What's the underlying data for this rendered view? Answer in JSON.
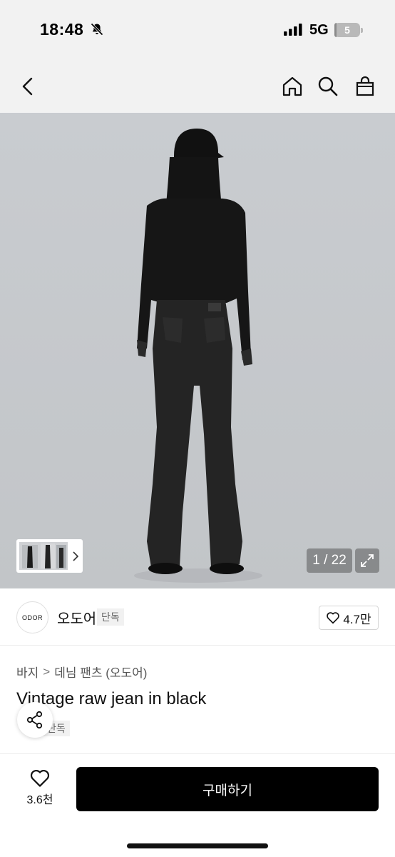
{
  "status_bar": {
    "time": "18:48",
    "network": "5G",
    "battery_level": "5",
    "battery_fraction": 0.05,
    "icons": [
      "bell-slash-icon",
      "signal-icon",
      "battery-icon"
    ]
  },
  "nav": {
    "icons": [
      "chevron-left-icon",
      "home-icon",
      "search-icon",
      "shopping-bag-icon"
    ]
  },
  "gallery": {
    "page_counter": "1 / 22",
    "icons": [
      "chevron-right-icon",
      "expand-icon"
    ]
  },
  "brand": {
    "logo_text": "ODOR",
    "name": "오도어",
    "badge": "단독",
    "like_count": "4.7만"
  },
  "product": {
    "breadcrumb": [
      "바지",
      "데님 팬츠 (오도어)"
    ],
    "breadcrumb_separator": ">",
    "title": "Vintage raw jean in black",
    "badge": "단독"
  },
  "bottom_bar": {
    "wish_count": "3.6천",
    "buy_label": "구매하기"
  },
  "colors": {
    "background": "#ffffff",
    "header": "#f2f2f2",
    "hero": "#c8cbcf",
    "buy_button": "#000000",
    "badge_bg": "#f1f1f1"
  }
}
